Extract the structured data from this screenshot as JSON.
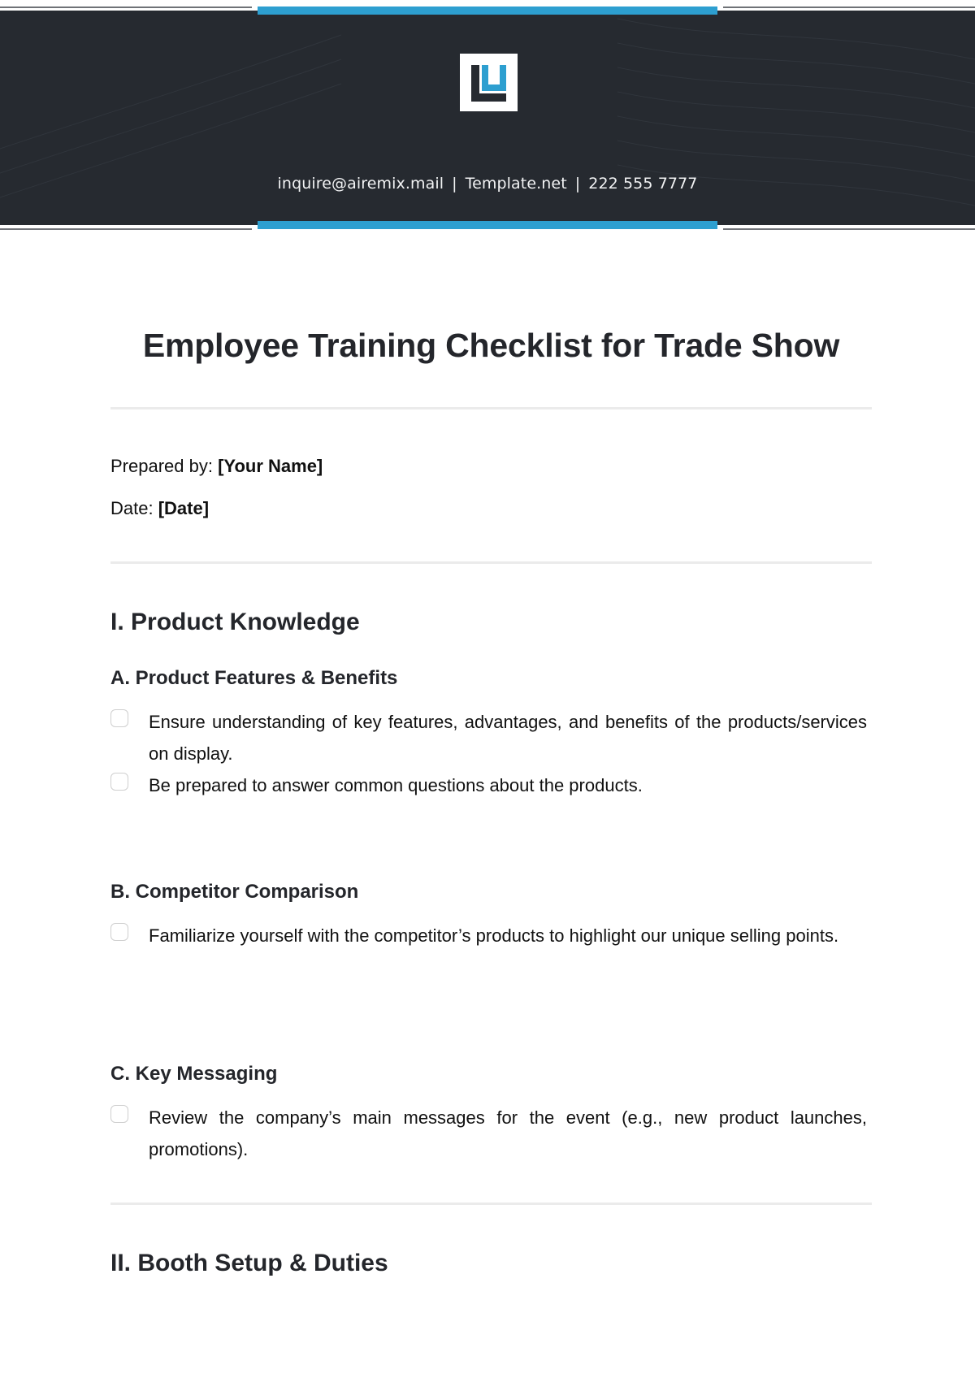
{
  "header": {
    "logo": "company-logo",
    "contact": {
      "email": "inquire@airemix.mail",
      "website": "Template.net",
      "phone": "222 555 7777",
      "separator": "|"
    }
  },
  "document": {
    "title": "Employee Training Checklist for Trade Show",
    "prepared_by_label": "Prepared by:",
    "prepared_by_value": "[Your Name]",
    "date_label": "Date:",
    "date_value": "[Date]"
  },
  "sections": [
    {
      "title": "I. Product Knowledge",
      "subsections": [
        {
          "title": "A. Product Features & Benefits",
          "items": [
            {
              "text": "Ensure understanding of key features, advantages, and benefits of the products/services on display.",
              "checked": false
            },
            {
              "text": "Be prepared to answer common questions about the products.",
              "checked": false
            }
          ]
        },
        {
          "title": "B. Competitor Comparison",
          "items": [
            {
              "text": "Familiarize yourself with the competitor’s products to highlight our unique selling points.",
              "checked": false
            }
          ]
        },
        {
          "title": "C. Key Messaging",
          "items": [
            {
              "text": "Review the company’s main messages for the event (e.g., new product launches, promotions).",
              "checked": false
            }
          ]
        }
      ]
    },
    {
      "title": "II. Booth Setup & Duties",
      "subsections": []
    }
  ],
  "colors": {
    "header_bg": "#262a30",
    "accent": "#2d9fd0",
    "text": "#24262b",
    "divider": "#ebebeb"
  }
}
